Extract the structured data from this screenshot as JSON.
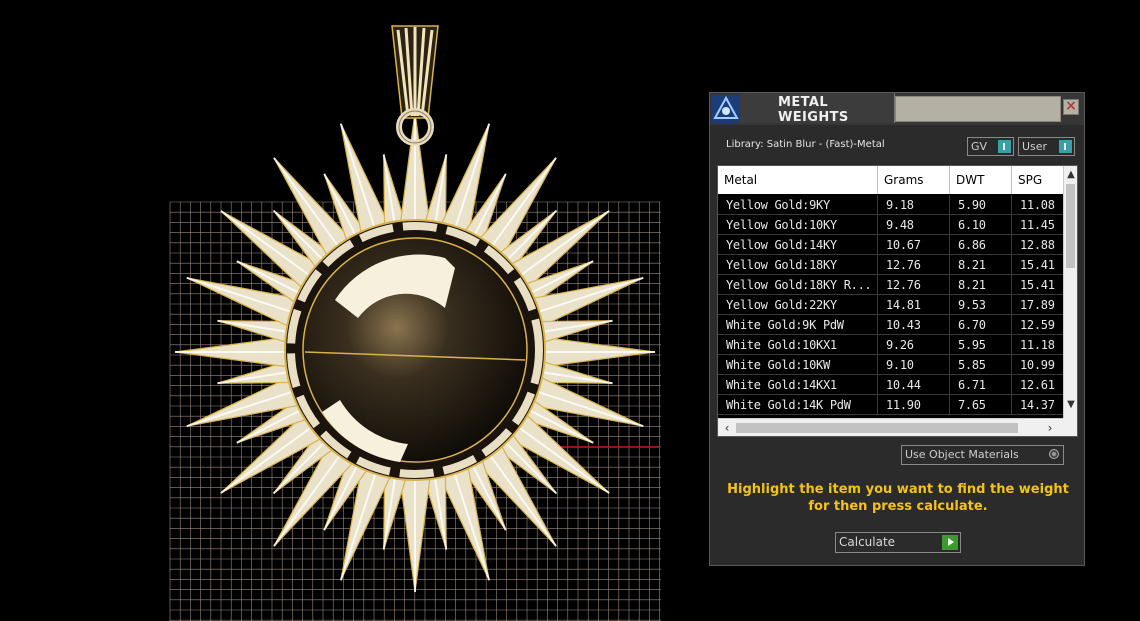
{
  "dialog": {
    "title": "METAL WEIGHTS",
    "close_icon": "close-icon",
    "library_label": "Library: Satin Blur - (Fast)-Metal",
    "toggles": [
      {
        "label": "GV",
        "icon": "toggle-switch-icon"
      },
      {
        "label": "User",
        "icon": "toggle-switch-icon"
      }
    ],
    "table": {
      "columns": [
        "Metal",
        "Grams",
        "DWT",
        "SPG"
      ],
      "rows": [
        [
          "Yellow Gold:9KY",
          "9.18",
          "5.90",
          "11.08"
        ],
        [
          "Yellow Gold:10KY",
          "9.48",
          "6.10",
          "11.45"
        ],
        [
          "Yellow Gold:14KY",
          "10.67",
          "6.86",
          "12.88"
        ],
        [
          "Yellow Gold:18KY",
          "12.76",
          "8.21",
          "15.41"
        ],
        [
          "Yellow Gold:18KY R...",
          "12.76",
          "8.21",
          "15.41"
        ],
        [
          "Yellow Gold:22KY",
          "14.81",
          "9.53",
          "17.89"
        ],
        [
          "White Gold:9K PdW",
          "10.43",
          "6.70",
          "12.59"
        ],
        [
          "White Gold:10KX1",
          "9.26",
          "5.95",
          "11.18"
        ],
        [
          "White Gold:10KW",
          "9.10",
          "5.85",
          "10.99"
        ],
        [
          "White Gold:14KX1",
          "10.44",
          "6.71",
          "12.61"
        ],
        [
          "White Gold:14K PdW",
          "11.90",
          "7.65",
          "14.37"
        ]
      ],
      "scroll_up_icon": "chevron-up-icon",
      "scroll_down_icon": "chevron-down-icon",
      "scroll_left_icon": "chevron-left-icon",
      "scroll_right_icon": "chevron-right-icon"
    },
    "use_object_materials_label": "Use Object Materials",
    "instruction_line1": "Highlight the item you want to find the weight",
    "instruction_line2": "for then press calculate.",
    "calculate_label": "Calculate",
    "calculate_icon": "play-icon"
  },
  "colors": {
    "background": "#000000",
    "panel": "#2b2b2b",
    "instruction_text": "#f6c21a",
    "toggle_accent": "#3b9fa8",
    "calculate_accent": "#3c9a2e",
    "metal_gold": "#d9b24a",
    "grid_line": "#9a8a7c"
  }
}
